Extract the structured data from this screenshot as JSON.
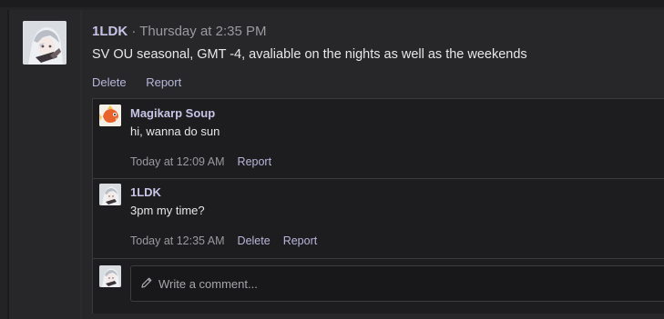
{
  "post": {
    "author": "1LDK",
    "separator": "·",
    "timestamp": "Thursday at 2:35 PM",
    "body": "SV OU seasonal, GMT -4, avaliable on the nights as well as the weekends",
    "actions": {
      "delete": "Delete",
      "report": "Report"
    }
  },
  "comments": [
    {
      "author": "Magikarp Soup",
      "text": "hi, wanna do sun",
      "timestamp": "Today at 12:09 AM",
      "actions": {
        "report": "Report"
      },
      "avatar_icon": "magikarp-avatar"
    },
    {
      "author": "1LDK",
      "text": "3pm my time?",
      "timestamp": "Today at 12:35 AM",
      "actions": {
        "delete": "Delete",
        "report": "Report"
      },
      "avatar_icon": "anime-character-avatar"
    }
  ],
  "reply": {
    "placeholder": "Write a comment...",
    "icon": "pencil-icon"
  },
  "colors": {
    "background": "#232325",
    "username": "#c7c4e6",
    "action_link": "#b8b6da",
    "muted": "#9a9a9f"
  }
}
